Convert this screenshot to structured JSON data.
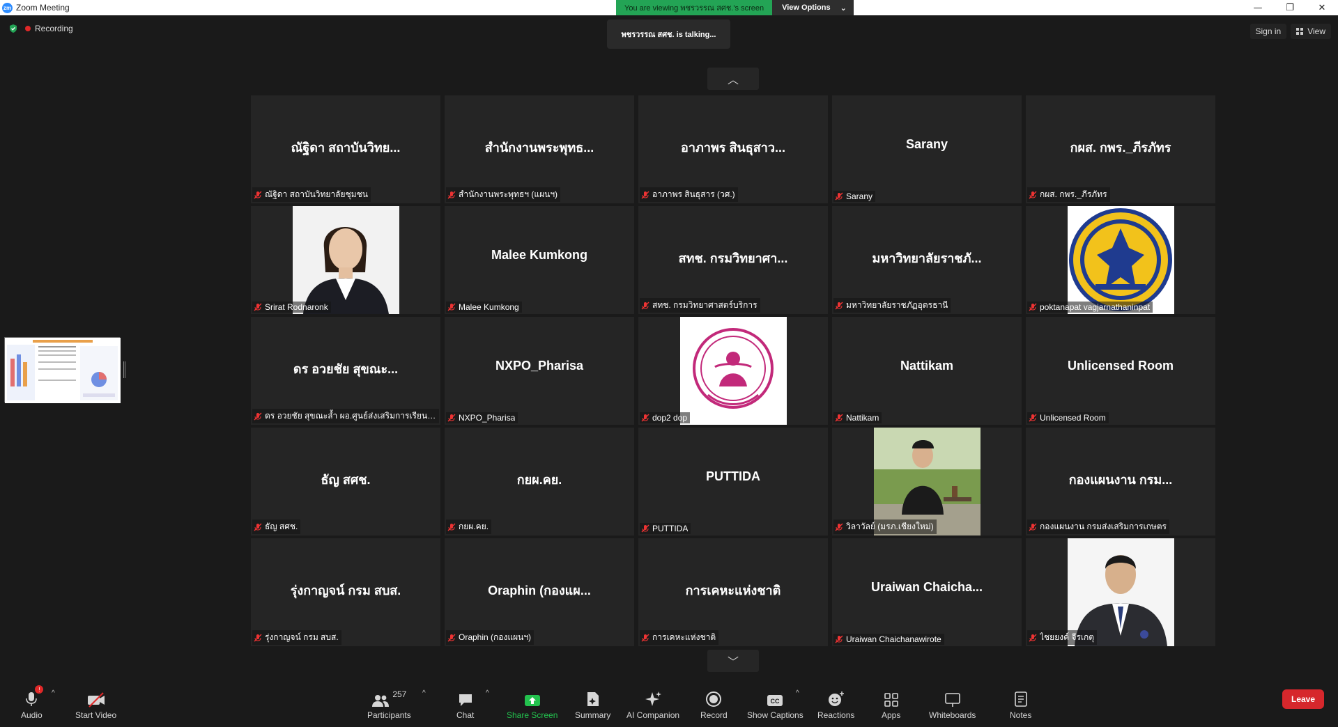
{
  "window": {
    "title": "Zoom Meeting",
    "logo_text": "zm",
    "minimize": "—",
    "restore": "❐",
    "close": "✕"
  },
  "banner": {
    "viewing_text": "You are viewing พชรวรรณ สศช.'s screen",
    "view_options_label": "View Options",
    "chevron": "⌄"
  },
  "status": {
    "recording_label": "Recording",
    "talking_text": "พชรวรรณ สศช. is talking..."
  },
  "top_right": {
    "sign_in_label": "Sign in",
    "view_label": "View"
  },
  "gallery": {
    "page_up": "︿",
    "page_down": "﹀",
    "tiles": [
      {
        "name": "ณัฐิดา สถาบันวิทย...",
        "label": "ณัฐิดา สถาบันวิทยาลัยชุมชน",
        "has_picture": false
      },
      {
        "name": "สำนักงานพระพุทธ...",
        "label": "สำนักงานพระพุทธฯ (แผนฯ)",
        "has_picture": false
      },
      {
        "name": "อาภาพร สินธุสาว...",
        "label": "อาภาพร สินธุสาร (วศ.)",
        "has_picture": false
      },
      {
        "name": "Sarany",
        "label": "Sarany",
        "has_picture": false
      },
      {
        "name": "กผส. กพร._ภีรภัทร",
        "label": "กผส. กพร._ภีรภัทร",
        "has_picture": false
      },
      {
        "name": "",
        "label": "Srirat Rodnaronk",
        "has_picture": true,
        "picture": "woman-portrait"
      },
      {
        "name": "Malee Kumkong",
        "label": "Malee Kumkong",
        "has_picture": false
      },
      {
        "name": "สทช. กรมวิทยาศา...",
        "label": "สทช. กรมวิทยาศาสตร์บริการ",
        "has_picture": false
      },
      {
        "name": "มหาวิทยาลัยราชภั...",
        "label": "มหาวิทยาลัยราชภัฏอุดรธานี",
        "has_picture": false
      },
      {
        "name": "",
        "label": "poktanapat vagjarnathaninpat",
        "has_picture": true,
        "picture": "gold-emblem"
      },
      {
        "name": "ดร อวยชัย สุขณะ...",
        "label": "ดร อวยชัย สุขณะล้ำ ผอ.ศูนย์ส่งเสริมการเรียนรู้ก...",
        "has_picture": false
      },
      {
        "name": "NXPO_Pharisa",
        "label": "NXPO_Pharisa",
        "has_picture": false
      },
      {
        "name": "",
        "label": "dop2 dop",
        "has_picture": true,
        "picture": "pink-seal"
      },
      {
        "name": "Nattikam",
        "label": "Nattikam",
        "has_picture": false
      },
      {
        "name": "Unlicensed Room",
        "label": "Unlicensed Room",
        "has_picture": false
      },
      {
        "name": "ธัญ สศช.",
        "label": "ธัญ สศช.",
        "has_picture": false
      },
      {
        "name": "กยผ.คย.",
        "label": "กยผ.คย.",
        "has_picture": false
      },
      {
        "name": "PUTTIDA",
        "label": "PUTTIDA",
        "has_picture": false
      },
      {
        "name": "",
        "label": "วิลาวัลย์ (มรภ.เชียงใหม่)",
        "has_picture": true,
        "picture": "man-outdoor"
      },
      {
        "name": "กองแผนงาน กรม...",
        "label": "กองแผนงาน กรมส่งเสริมการเกษตร",
        "has_picture": false
      },
      {
        "name": "รุ่งกาญจน์ กรม สบส.",
        "label": "รุ่งกาญจน์ กรม สบส.",
        "has_picture": false
      },
      {
        "name": "Oraphin (กองแผ...",
        "label": "Oraphin (กองแผนฯ)",
        "has_picture": false
      },
      {
        "name": "การเคหะแห่งชาติ",
        "label": "การเคหะแห่งชาติ",
        "has_picture": false
      },
      {
        "name": "Uraiwan Chaicha...",
        "label": "Uraiwan Chaichanawirote",
        "has_picture": false
      },
      {
        "name": "",
        "label": "ไชยยงค์ จีรเกตุ",
        "has_picture": true,
        "picture": "man-suit"
      }
    ]
  },
  "toolbar": {
    "audio_label": "Audio",
    "audio_badge": "!",
    "start_video_label": "Start Video",
    "participants_label": "Participants",
    "participants_count": "257",
    "chat_label": "Chat",
    "share_screen_label": "Share Screen",
    "summary_label": "Summary",
    "ai_companion_label": "AI Companion",
    "record_label": "Record",
    "show_captions_label": "Show Captions",
    "reactions_label": "Reactions",
    "apps_label": "Apps",
    "whiteboards_label": "Whiteboards",
    "notes_label": "Notes",
    "leave_label": "Leave",
    "caret": "^"
  },
  "colors": {
    "background": "#1a1a1a",
    "tile": "#252525",
    "share_green": "#23c24e",
    "leave_red": "#d6272c",
    "banner_green": "#23a455"
  }
}
